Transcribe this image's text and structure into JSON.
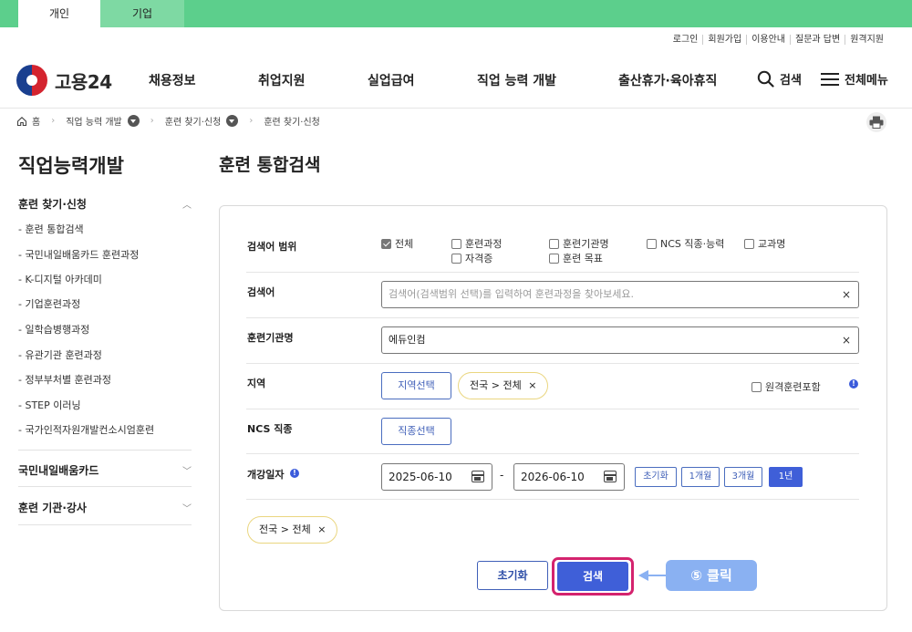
{
  "top_tabs": {
    "personal": "개인",
    "business": "기업"
  },
  "util_links": [
    "로그인",
    "회원가입",
    "이용안내",
    "질문과 답변",
    "원격지원"
  ],
  "logo": {
    "text": "고용24"
  },
  "gnb": [
    "채용정보",
    "취업지원",
    "실업급여",
    "직업 능력 개발",
    "출산휴가·육아휴직"
  ],
  "header_actions": {
    "search": "검색",
    "all_menu": "전체메뉴"
  },
  "breadcrumb": {
    "home": "홈",
    "level1": "직업 능력 개발",
    "level2": "훈련 찾기·신청",
    "level3": "훈련 찾기·신청"
  },
  "sidebar": {
    "title": "직업능력개발",
    "section1": "훈련 찾기·신청",
    "items": [
      "- 훈련 통합검색",
      "- 국민내일배움카드 훈련과정",
      "- K-디지털 아카데미",
      "- 기업훈련과정",
      "- 일학습병행과정",
      "- 유관기관 훈련과정",
      "- 정부부처별 훈련과정",
      "- STEP 이러닝",
      "- 국가인적자원개발컨소시엄훈련"
    ],
    "section2": "국민내일배움카드",
    "section3": "훈련 기관·강사"
  },
  "page_title": "훈련 통합검색",
  "form": {
    "scope_label": "검색어 범위",
    "scope_options": {
      "all": "전체",
      "course": "훈련과정",
      "institution": "훈련기관명",
      "ncs": "NCS 직종·능력",
      "subject": "교과명",
      "license": "자격증",
      "goal": "훈련 목표"
    },
    "keyword_label": "검색어",
    "keyword_placeholder": "검색어(검색범위 선택)를 입력하여 훈련과정을 찾아보세요.",
    "clear_glyph": "×",
    "institution_label": "훈련기관명",
    "institution_value": "에듀인컴",
    "region_label": "지역",
    "region_button": "지역선택",
    "region_chip": "전국 > 전체",
    "remote_label": "원격훈련포함",
    "ncs_label": "NCS 직종",
    "ncs_button": "직종선택",
    "date_label": "개강일자",
    "date_from": "2025-06-10",
    "date_sep": "-",
    "date_to": "2026-06-10",
    "periods": [
      "초기화",
      "1개월",
      "3개월",
      "1년"
    ],
    "selected_chip": "전국 > 전체",
    "reset_button": "초기화",
    "search_button": "검색"
  },
  "annotation": {
    "callout": "⑤ 클릭"
  },
  "colors": {
    "brand_green": "#5ccf8c",
    "primary_blue": "#3f5fd8",
    "highlight": "#d4236e",
    "callout": "#8ab1f2"
  }
}
